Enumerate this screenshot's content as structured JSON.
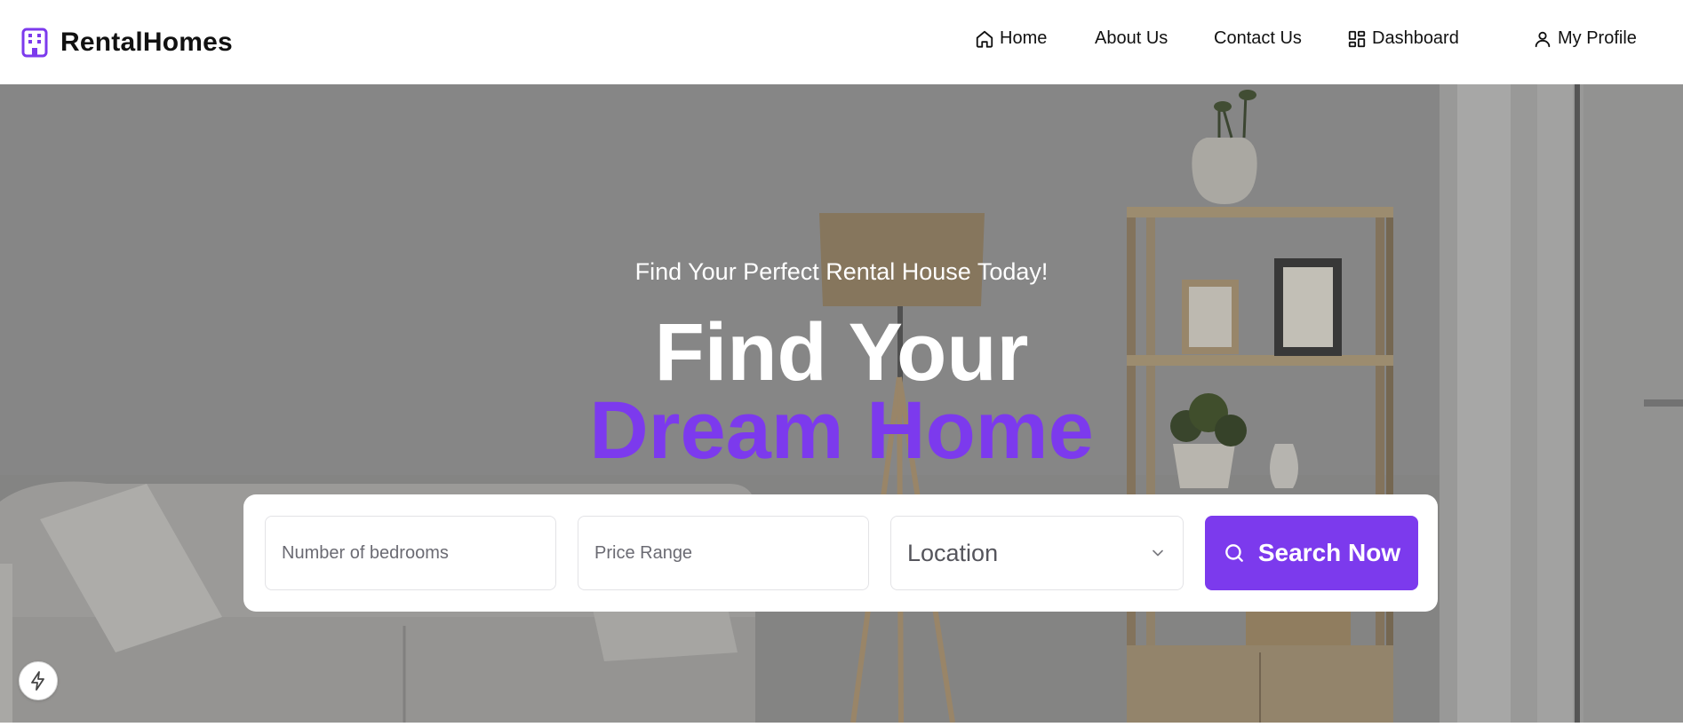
{
  "brand": {
    "name": "RentalHomes",
    "icon": "building-icon",
    "color": "#7c3aed"
  },
  "nav": {
    "home": {
      "label": "Home",
      "icon": "home-icon"
    },
    "about": {
      "label": "About Us"
    },
    "contact": {
      "label": "Contact Us"
    },
    "dashboard": {
      "label": "Dashboard",
      "icon": "dashboard-icon"
    },
    "profile": {
      "label": "My Profile",
      "icon": "user-icon"
    }
  },
  "hero": {
    "subtitle": "Find Your Perfect Rental House Today!",
    "title_line1": "Find Your",
    "title_line2": "Dream Home",
    "accent_color": "#7c3aed"
  },
  "search": {
    "bedrooms_placeholder": "Number of bedrooms",
    "price_placeholder": "Price Range",
    "location_selected": "Location",
    "button_label": "Search Now"
  },
  "floating": {
    "icon": "bolt-icon"
  }
}
